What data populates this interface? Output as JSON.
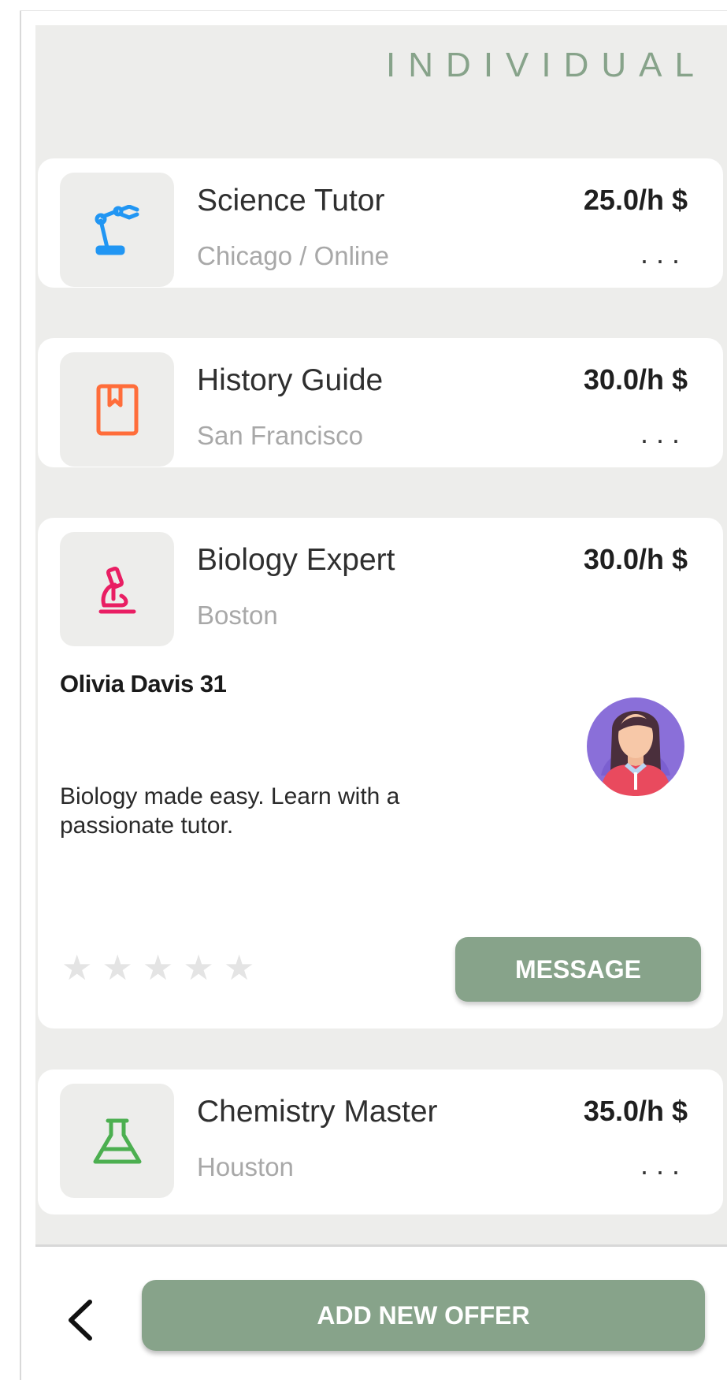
{
  "header": {
    "title": "INDIVIDUAL"
  },
  "offers": [
    {
      "title": "Science Tutor",
      "location": "Chicago / Online",
      "price": "25.0/h $",
      "more": "...",
      "icon": "robot-arm-icon",
      "icon_color": "#2196f3"
    },
    {
      "title": "History Guide",
      "location": "San Francisco",
      "price": "30.0/h $",
      "more": "...",
      "icon": "book-icon",
      "icon_color": "#ff6d3a"
    },
    {
      "title": "Biology Expert",
      "location": "Boston",
      "price": "30.0/h $",
      "icon": "microscope-icon",
      "icon_color": "#e91e63",
      "tutor_name": "Olivia Davis 31",
      "description": "Biology made easy. Learn with a passionate tutor.",
      "rating": 0,
      "rating_max": 5,
      "message_label": "MESSAGE"
    },
    {
      "title": "Chemistry Master",
      "location": "Houston",
      "price": "35.0/h $",
      "more": "...",
      "icon": "flask-icon",
      "icon_color": "#4caf50"
    }
  ],
  "footer": {
    "add_label": "ADD NEW OFFER",
    "back_icon": "chevron-left-icon"
  },
  "colors": {
    "accent": "#87a38a",
    "background": "#ededeb",
    "card": "#ffffff"
  }
}
